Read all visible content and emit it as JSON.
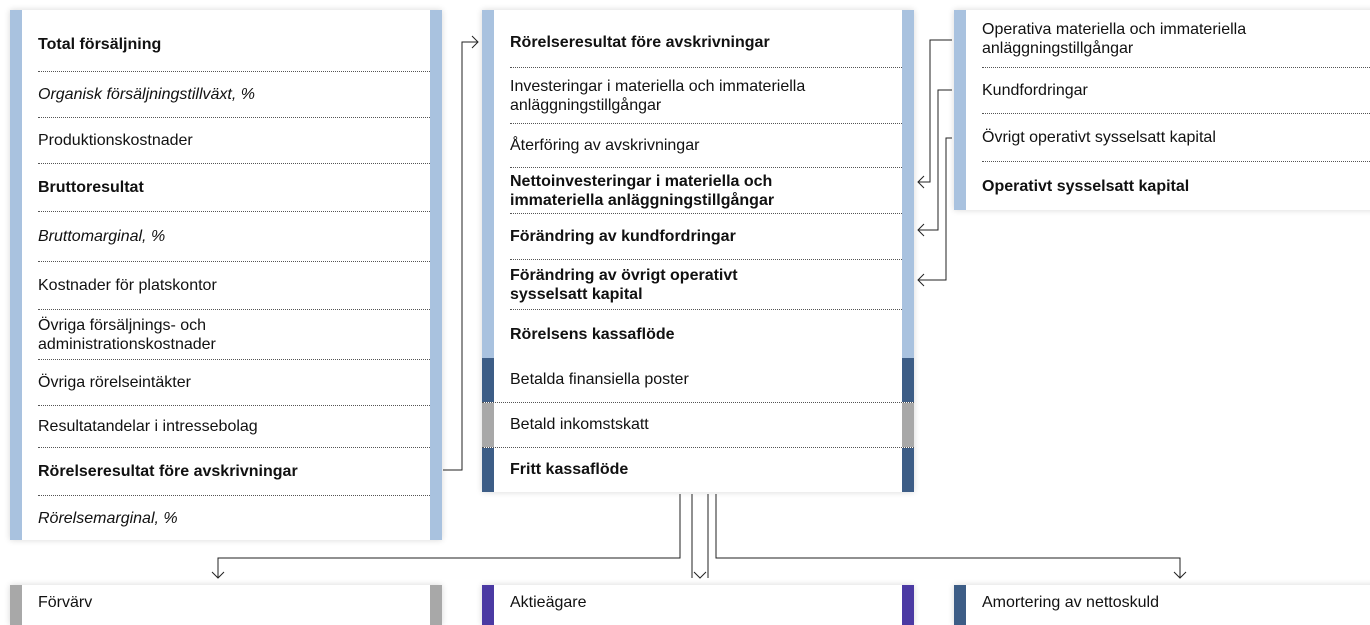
{
  "colors": {
    "light_blue": "#a9c2df",
    "dark_blue": "#3d5d86",
    "gray": "#a8a8a8",
    "purple": "#4b3aa3"
  },
  "left_box": [
    {
      "text": "Total försäljning",
      "style": "bold"
    },
    {
      "text": "Organisk försäljningstillväxt, %",
      "style": "italic"
    },
    {
      "text": "Produktionskostnader",
      "style": "normal"
    },
    {
      "text": "Bruttoresultat",
      "style": "bold"
    },
    {
      "text": "Bruttomarginal, %",
      "style": "italic"
    },
    {
      "text": "Kostnader för platskontor",
      "style": "normal"
    },
    {
      "text": "Övriga försäljnings- och administrationskostnader",
      "style": "normal"
    },
    {
      "text": "Övriga rörelseintäkter",
      "style": "normal"
    },
    {
      "text": "Resultatandelar i intressebolag",
      "style": "normal"
    },
    {
      "text": "Rörelseresultat före avskrivningar",
      "style": "bold"
    },
    {
      "text": "Rörelsemarginal, %",
      "style": "italic"
    }
  ],
  "middle_box": [
    {
      "text": "Rörelseresultat före avskrivningar",
      "style": "bold"
    },
    {
      "text": "Investeringar i materiella och immateriella anläggningstillgångar",
      "style": "normal"
    },
    {
      "text": "Återföring av avskrivningar",
      "style": "normal"
    },
    {
      "text": "Nettoinvesteringar i materiella och immateriella anläggningstillgångar",
      "style": "bold"
    },
    {
      "text": "Förändring av kundfordringar",
      "style": "bold"
    },
    {
      "text": "Förändring av övrigt operativt sysselsatt kapital",
      "style": "bold"
    },
    {
      "text": "Rörelsens kassaflöde",
      "style": "bold"
    }
  ],
  "middle_lower": [
    {
      "text": "Betalda finansiella poster",
      "style": "normal",
      "bar": "dark_blue"
    },
    {
      "text": "Betald inkomstskatt",
      "style": "normal",
      "bar": "gray"
    },
    {
      "text": "Fritt kassaflöde",
      "style": "bold",
      "bar": "dark_blue"
    }
  ],
  "right_box": [
    {
      "text": "Operativa materiella och immateriella anläggningstillgångar",
      "style": "normal"
    },
    {
      "text": "Kundfordringar",
      "style": "normal"
    },
    {
      "text": "Övrigt operativt sysselsatt kapital",
      "style": "normal"
    },
    {
      "text": "Operativt sysselsatt kapital",
      "style": "bold"
    }
  ],
  "bottom_boxes": [
    {
      "text": "Förvärv",
      "bar": "gray"
    },
    {
      "text": "Aktieägare",
      "bar": "purple"
    },
    {
      "text": "Amortering av nettoskuld",
      "bar": "dark_blue"
    }
  ]
}
